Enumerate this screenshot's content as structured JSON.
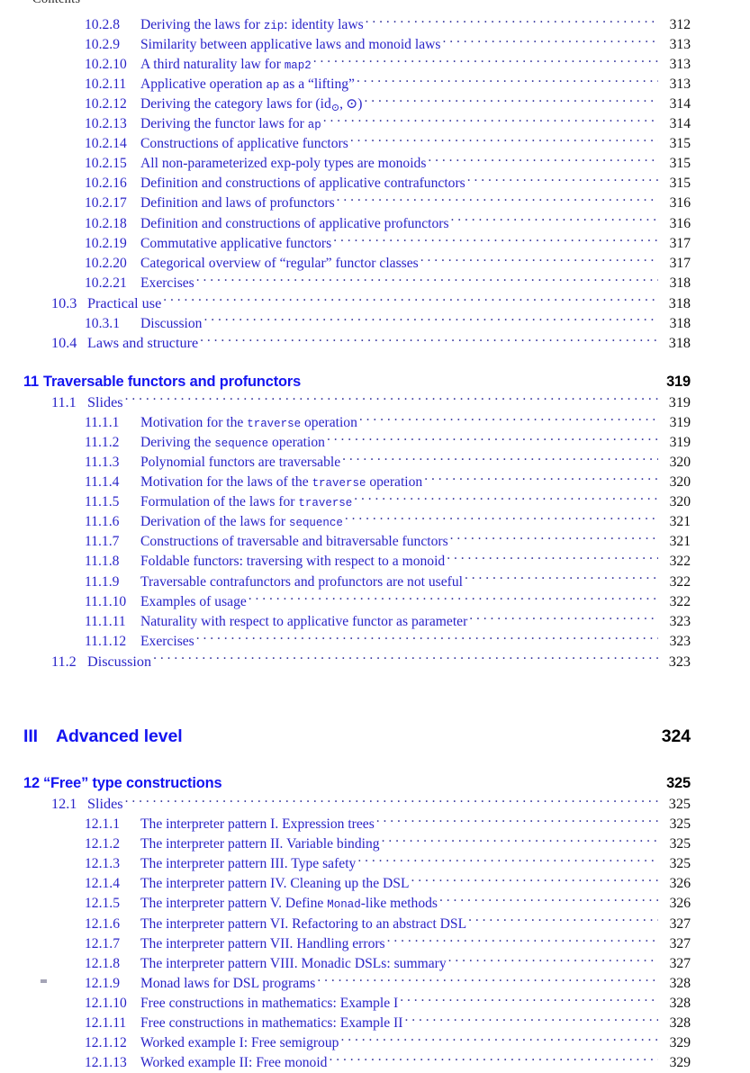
{
  "document": {
    "running_header": "Contents",
    "text_color": "#2a24c8",
    "heading_color": "#1414f0",
    "page_number_color": "#111111"
  },
  "entries": [
    {
      "level": "subsubsection",
      "number": "10.2.8",
      "title_html": "Deriving the laws for <code>zip</code>: identity laws",
      "title_text": "Deriving the laws for zip: identity laws",
      "page": "312"
    },
    {
      "level": "subsubsection",
      "number": "10.2.9",
      "title_html": "Similarity between applicative laws and monoid laws",
      "title_text": "Similarity between applicative laws and monoid laws",
      "page": "313"
    },
    {
      "level": "subsubsection",
      "number": "10.2.10",
      "title_html": "A third naturality law for <code>map2</code>",
      "title_text": "A third naturality law for map2",
      "page": "313"
    },
    {
      "level": "subsubsection",
      "number": "10.2.11",
      "title_html": "Applicative operation <code>ap</code> as a “lifting”",
      "title_text": "Applicative operation ap as a “lifting”",
      "page": "313"
    },
    {
      "level": "subsubsection",
      "number": "10.2.12",
      "title_html": "Deriving the category laws for (id<span class=\"sub\">⊙</span>, ⊙)",
      "title_text": "Deriving the category laws for (id⊙, ⊙)",
      "page": "314"
    },
    {
      "level": "subsubsection",
      "number": "10.2.13",
      "title_html": "Deriving the functor laws for <code>ap</code>",
      "title_text": "Deriving the functor laws for ap",
      "page": "314"
    },
    {
      "level": "subsubsection",
      "number": "10.2.14",
      "title_html": "Constructions of applicative functors",
      "title_text": "Constructions of applicative functors",
      "page": "315"
    },
    {
      "level": "subsubsection",
      "number": "10.2.15",
      "title_html": "All non-parameterized exp-poly types are monoids",
      "title_text": "All non-parameterized exp-poly types are monoids",
      "page": "315"
    },
    {
      "level": "subsubsection",
      "number": "10.2.16",
      "title_html": "Definition and constructions of applicative contrafunctors",
      "title_text": "Definition and constructions of applicative contrafunctors",
      "page": "315"
    },
    {
      "level": "subsubsection",
      "number": "10.2.17",
      "title_html": "Definition and laws of profunctors",
      "title_text": "Definition and laws of profunctors",
      "page": "316"
    },
    {
      "level": "subsubsection",
      "number": "10.2.18",
      "title_html": "Definition and constructions of applicative profunctors",
      "title_text": "Definition and constructions of applicative profunctors",
      "page": "316"
    },
    {
      "level": "subsubsection",
      "number": "10.2.19",
      "title_html": "Commutative applicative functors",
      "title_text": "Commutative applicative functors",
      "page": "317"
    },
    {
      "level": "subsubsection",
      "number": "10.2.20",
      "title_html": "Categorical overview of “regular” functor classes",
      "title_text": "Categorical overview of “regular” functor classes",
      "page": "317"
    },
    {
      "level": "subsubsection",
      "number": "10.2.21",
      "title_html": "Exercises",
      "title_text": "Exercises",
      "page": "318"
    },
    {
      "level": "section",
      "number": "10.3",
      "title_html": "Practical use",
      "title_text": "Practical use",
      "page": "318"
    },
    {
      "level": "subsubsection",
      "number": "10.3.1",
      "title_html": "Discussion",
      "title_text": "Discussion",
      "page": "318"
    },
    {
      "level": "section",
      "number": "10.4",
      "title_html": "Laws and structure",
      "title_text": "Laws and structure",
      "page": "318"
    },
    {
      "level": "gap-chapter"
    },
    {
      "level": "chapter",
      "number": "11",
      "title_html": "Traversable functors and profunctors",
      "title_text": "Traversable functors and profunctors",
      "page": "319"
    },
    {
      "level": "section",
      "number": "11.1",
      "title_html": "Slides",
      "title_text": "Slides",
      "page": "319"
    },
    {
      "level": "subsubsection",
      "number": "11.1.1",
      "title_html": "Motivation for the <code>traverse</code> operation",
      "title_text": "Motivation for the traverse operation",
      "page": "319"
    },
    {
      "level": "subsubsection",
      "number": "11.1.2",
      "title_html": "Deriving the <code>sequence</code> operation",
      "title_text": "Deriving the sequence operation",
      "page": "319"
    },
    {
      "level": "subsubsection",
      "number": "11.1.3",
      "title_html": "Polynomial functors are traversable",
      "title_text": "Polynomial functors are traversable",
      "page": "320"
    },
    {
      "level": "subsubsection",
      "number": "11.1.4",
      "title_html": "Motivation for the laws of the <code>traverse</code> operation",
      "title_text": "Motivation for the laws of the traverse operation",
      "page": "320"
    },
    {
      "level": "subsubsection",
      "number": "11.1.5",
      "title_html": "Formulation of the laws for <code>traverse</code>",
      "title_text": "Formulation of the laws for traverse",
      "page": "320"
    },
    {
      "level": "subsubsection",
      "number": "11.1.6",
      "title_html": "Derivation of the laws for <code>sequence</code>",
      "title_text": "Derivation of the laws for sequence",
      "page": "321"
    },
    {
      "level": "subsubsection",
      "number": "11.1.7",
      "title_html": "Constructions of traversable and bitraversable functors",
      "title_text": "Constructions of traversable and bitraversable functors",
      "page": "321"
    },
    {
      "level": "subsubsection",
      "number": "11.1.8",
      "title_html": "Foldable functors: traversing with respect to a monoid",
      "title_text": "Foldable functors: traversing with respect to a monoid",
      "page": "322"
    },
    {
      "level": "subsubsection",
      "number": "11.1.9",
      "title_html": "Traversable contrafunctors and profunctors are not useful",
      "title_text": "Traversable contrafunctors and profunctors are not useful",
      "page": "322"
    },
    {
      "level": "subsubsection",
      "number": "11.1.10",
      "title_html": "Examples of usage",
      "title_text": "Examples of usage",
      "page": "322"
    },
    {
      "level": "subsubsection",
      "number": "11.1.11",
      "title_html": "Naturality with respect to applicative functor as parameter",
      "title_text": "Naturality with respect to applicative functor as parameter",
      "page": "323"
    },
    {
      "level": "subsubsection",
      "number": "11.1.12",
      "title_html": "Exercises",
      "title_text": "Exercises",
      "page": "323"
    },
    {
      "level": "section",
      "number": "11.2",
      "title_html": "Discussion",
      "title_text": "Discussion",
      "page": "323"
    },
    {
      "level": "gap-part"
    },
    {
      "level": "part",
      "number": "III",
      "title_html": "Advanced level",
      "title_text": "Advanced level",
      "page": "324"
    },
    {
      "level": "gap-after-part"
    },
    {
      "level": "chapter",
      "number": "12",
      "title_html": "“Free” type constructions",
      "title_text": "“Free” type constructions",
      "page": "325"
    },
    {
      "level": "section",
      "number": "12.1",
      "title_html": "Slides",
      "title_text": "Slides",
      "page": "325"
    },
    {
      "level": "subsubsection",
      "number": "12.1.1",
      "title_html": "The interpreter pattern I. Expression trees",
      "title_text": "The interpreter pattern I. Expression trees",
      "page": "325"
    },
    {
      "level": "subsubsection",
      "number": "12.1.2",
      "title_html": "The interpreter pattern II. Variable binding",
      "title_text": "The interpreter pattern II. Variable binding",
      "page": "325"
    },
    {
      "level": "subsubsection",
      "number": "12.1.3",
      "title_html": "The interpreter pattern III. Type safety",
      "title_text": "The interpreter pattern III. Type safety",
      "page": "325"
    },
    {
      "level": "subsubsection",
      "number": "12.1.4",
      "title_html": "The interpreter pattern IV. Cleaning up the DSL",
      "title_text": "The interpreter pattern IV. Cleaning up the DSL",
      "page": "326"
    },
    {
      "level": "subsubsection",
      "number": "12.1.5",
      "title_html": "The interpreter pattern V. Define <code>Monad</code>-like methods",
      "title_text": "The interpreter pattern V. Define Monad-like methods",
      "page": "326"
    },
    {
      "level": "subsubsection",
      "number": "12.1.6",
      "title_html": "The interpreter pattern VI. Refactoring to an abstract DSL",
      "title_text": "The interpreter pattern VI. Refactoring to an abstract DSL",
      "page": "327"
    },
    {
      "level": "subsubsection",
      "number": "12.1.7",
      "title_html": "The interpreter pattern VII. Handling errors",
      "title_text": "The interpreter pattern VII. Handling errors",
      "page": "327"
    },
    {
      "level": "subsubsection",
      "number": "12.1.8",
      "title_html": "The interpreter pattern VIII. Monadic DSLs: summary",
      "title_text": "The interpreter pattern VIII. Monadic DSLs: summary",
      "page": "327"
    },
    {
      "level": "subsubsection",
      "number": "12.1.9",
      "title_html": "Monad laws for DSL programs",
      "title_text": "Monad laws for DSL programs",
      "page": "328"
    },
    {
      "level": "subsubsection",
      "number": "12.1.10",
      "title_html": "Free constructions in mathematics: Example I",
      "title_text": "Free constructions in mathematics: Example I",
      "page": "328"
    },
    {
      "level": "subsubsection",
      "number": "12.1.11",
      "title_html": "Free constructions in mathematics: Example II",
      "title_text": "Free constructions in mathematics: Example II",
      "page": "328"
    },
    {
      "level": "subsubsection",
      "number": "12.1.12",
      "title_html": "Worked example I: Free semigroup",
      "title_text": "Worked example I: Free semigroup",
      "page": "329"
    },
    {
      "level": "subsubsection",
      "number": "12.1.13",
      "title_html": "Worked example II: Free monoid",
      "title_text": "Worked example II: Free monoid",
      "page": "329"
    }
  ]
}
